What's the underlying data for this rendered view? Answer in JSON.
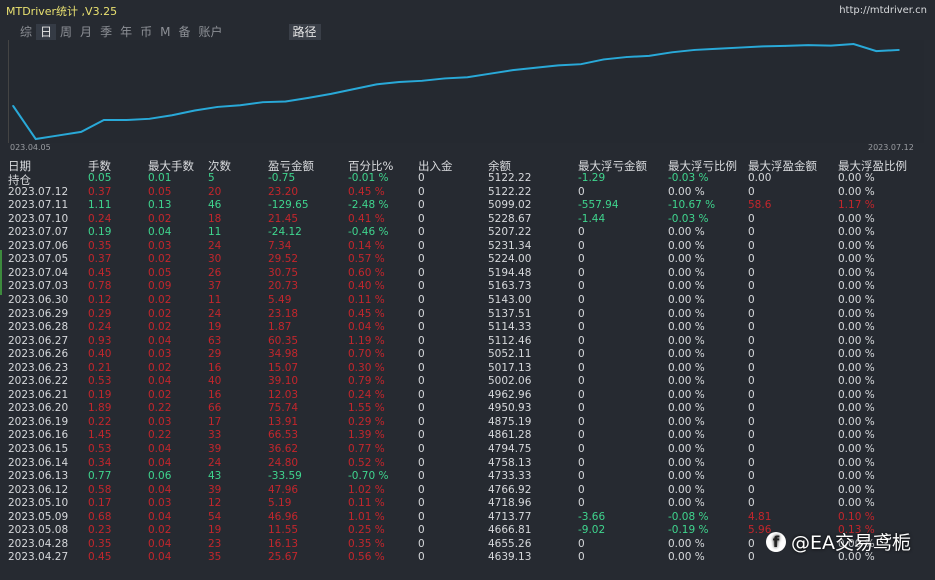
{
  "window": {
    "title": "MTDriver统计 ,V3.25",
    "url": "http://mtdriver.cn"
  },
  "tabs": [
    {
      "label": "综"
    },
    {
      "label": "日",
      "active": true
    },
    {
      "label": "周"
    },
    {
      "label": "月"
    },
    {
      "label": "季"
    },
    {
      "label": "年"
    },
    {
      "label": "币"
    },
    {
      "label": "M"
    },
    {
      "label": "备"
    },
    {
      "label": "账户"
    }
  ],
  "path_tab": "路径",
  "chart_data": {
    "type": "line",
    "x_start_label": "023.04.05",
    "x_end_label": "2023.07.12",
    "series": [
      {
        "name": "balance",
        "values": [
          4700,
          4560,
          4575,
          4590,
          4640,
          4640,
          4645,
          4660,
          4680,
          4695,
          4702,
          4715,
          4718,
          4733,
          4750,
          4770,
          4790,
          4800,
          4805,
          4815,
          4820,
          4835,
          4850,
          4860,
          4870,
          4875,
          4895,
          4905,
          4910,
          4925,
          4935,
          4940,
          4945,
          4950,
          4952,
          4955,
          4953,
          4960,
          4930,
          4935
        ]
      }
    ]
  },
  "table": {
    "headers": [
      "日期",
      "手数",
      "最大手数",
      "次数",
      "盈亏金额",
      "百分比%",
      "出入金",
      "余额",
      "最大浮亏金额",
      "最大浮亏比例",
      "最大浮盈金额",
      "最大浮盈比例"
    ],
    "rows": [
      {
        "c": "green",
        "v": [
          "持仓",
          "0.05",
          "0.01",
          "5",
          "-0.75",
          "-0.01 %",
          "0",
          "5122.22",
          "-1.29",
          "-0.03 %",
          "0.00",
          "0.00 %"
        ]
      },
      {
        "c": "red",
        "v": [
          "2023.07.12",
          "0.37",
          "0.05",
          "20",
          "23.20",
          "0.45 %",
          "0",
          "5122.22",
          "0",
          "0.00 %",
          "0",
          "0.00 %"
        ]
      },
      {
        "c": "green",
        "v": [
          "2023.07.11",
          "1.11",
          "0.13",
          "46",
          "-129.65",
          "-2.48 %",
          "0",
          "5099.02",
          "-557.94",
          "-10.67 %",
          "58.6",
          "1.17 %"
        ]
      },
      {
        "c": "red",
        "v": [
          "2023.07.10",
          "0.24",
          "0.02",
          "18",
          "21.45",
          "0.41 %",
          "0",
          "5228.67",
          "-1.44",
          "-0.03 %",
          "0",
          "0.00 %"
        ]
      },
      {
        "c": "green",
        "v": [
          "2023.07.07",
          "0.19",
          "0.04",
          "11",
          "-24.12",
          "-0.46 %",
          "0",
          "5207.22",
          "0",
          "0.00 %",
          "0",
          "0.00 %"
        ]
      },
      {
        "c": "red",
        "v": [
          "2023.07.06",
          "0.35",
          "0.03",
          "24",
          "7.34",
          "0.14 %",
          "0",
          "5231.34",
          "0",
          "0.00 %",
          "0",
          "0.00 %"
        ]
      },
      {
        "c": "red",
        "v": [
          "2023.07.05",
          "0.37",
          "0.02",
          "30",
          "29.52",
          "0.57 %",
          "0",
          "5224.00",
          "0",
          "0.00 %",
          "0",
          "0.00 %"
        ]
      },
      {
        "c": "red",
        "v": [
          "2023.07.04",
          "0.45",
          "0.05",
          "26",
          "30.75",
          "0.60 %",
          "0",
          "5194.48",
          "0",
          "0.00 %",
          "0",
          "0.00 %"
        ]
      },
      {
        "c": "red",
        "v": [
          "2023.07.03",
          "0.78",
          "0.09",
          "37",
          "20.73",
          "0.40 %",
          "0",
          "5163.73",
          "0",
          "0.00 %",
          "0",
          "0.00 %"
        ]
      },
      {
        "c": "red",
        "v": [
          "2023.06.30",
          "0.12",
          "0.02",
          "11",
          "5.49",
          "0.11 %",
          "0",
          "5143.00",
          "0",
          "0.00 %",
          "0",
          "0.00 %"
        ]
      },
      {
        "c": "red",
        "v": [
          "2023.06.29",
          "0.29",
          "0.02",
          "24",
          "23.18",
          "0.45 %",
          "0",
          "5137.51",
          "0",
          "0.00 %",
          "0",
          "0.00 %"
        ]
      },
      {
        "c": "red",
        "v": [
          "2023.06.28",
          "0.24",
          "0.02",
          "19",
          "1.87",
          "0.04 %",
          "0",
          "5114.33",
          "0",
          "0.00 %",
          "0",
          "0.00 %"
        ]
      },
      {
        "c": "red",
        "v": [
          "2023.06.27",
          "0.93",
          "0.04",
          "63",
          "60.35",
          "1.19 %",
          "0",
          "5112.46",
          "0",
          "0.00 %",
          "0",
          "0.00 %"
        ]
      },
      {
        "c": "red",
        "v": [
          "2023.06.26",
          "0.40",
          "0.03",
          "29",
          "34.98",
          "0.70 %",
          "0",
          "5052.11",
          "0",
          "0.00 %",
          "0",
          "0.00 %"
        ]
      },
      {
        "c": "red",
        "v": [
          "2023.06.23",
          "0.21",
          "0.02",
          "16",
          "15.07",
          "0.30 %",
          "0",
          "5017.13",
          "0",
          "0.00 %",
          "0",
          "0.00 %"
        ]
      },
      {
        "c": "red",
        "v": [
          "2023.06.22",
          "0.53",
          "0.04",
          "40",
          "39.10",
          "0.79 %",
          "0",
          "5002.06",
          "0",
          "0.00 %",
          "0",
          "0.00 %"
        ]
      },
      {
        "c": "red",
        "v": [
          "2023.06.21",
          "0.19",
          "0.02",
          "16",
          "12.03",
          "0.24 %",
          "0",
          "4962.96",
          "0",
          "0.00 %",
          "0",
          "0.00 %"
        ]
      },
      {
        "c": "red",
        "v": [
          "2023.06.20",
          "1.89",
          "0.22",
          "66",
          "75.74",
          "1.55 %",
          "0",
          "4950.93",
          "0",
          "0.00 %",
          "0",
          "0.00 %"
        ]
      },
      {
        "c": "red",
        "v": [
          "2023.06.19",
          "0.22",
          "0.03",
          "17",
          "13.91",
          "0.29 %",
          "0",
          "4875.19",
          "0",
          "0.00 %",
          "0",
          "0.00 %"
        ]
      },
      {
        "c": "red",
        "v": [
          "2023.06.16",
          "1.45",
          "0.22",
          "33",
          "66.53",
          "1.39 %",
          "0",
          "4861.28",
          "0",
          "0.00 %",
          "0",
          "0.00 %"
        ]
      },
      {
        "c": "red",
        "v": [
          "2023.06.15",
          "0.53",
          "0.04",
          "39",
          "36.62",
          "0.77 %",
          "0",
          "4794.75",
          "0",
          "0.00 %",
          "0",
          "0.00 %"
        ]
      },
      {
        "c": "red",
        "v": [
          "2023.06.14",
          "0.34",
          "0.04",
          "24",
          "24.80",
          "0.52 %",
          "0",
          "4758.13",
          "0",
          "0.00 %",
          "0",
          "0.00 %"
        ]
      },
      {
        "c": "green",
        "v": [
          "2023.06.13",
          "0.77",
          "0.06",
          "43",
          "-33.59",
          "-0.70 %",
          "0",
          "4733.33",
          "0",
          "0.00 %",
          "0",
          "0.00 %"
        ]
      },
      {
        "c": "red",
        "v": [
          "2023.06.12",
          "0.58",
          "0.04",
          "39",
          "47.96",
          "1.02 %",
          "0",
          "4766.92",
          "0",
          "0.00 %",
          "0",
          "0.00 %"
        ]
      },
      {
        "c": "red",
        "v": [
          "2023.05.10",
          "0.17",
          "0.03",
          "12",
          "5.19",
          "0.11 %",
          "0",
          "4718.96",
          "0",
          "0.00 %",
          "0",
          "0.00 %"
        ]
      },
      {
        "c": "red",
        "v": [
          "2023.05.09",
          "0.68",
          "0.04",
          "54",
          "46.96",
          "1.01 %",
          "0",
          "4713.77",
          "-3.66",
          "-0.08 %",
          "4.81",
          "0.10 %"
        ]
      },
      {
        "c": "red",
        "v": [
          "2023.05.08",
          "0.23",
          "0.02",
          "19",
          "11.55",
          "0.25 %",
          "0",
          "4666.81",
          "-9.02",
          "-0.19 %",
          "5.96",
          "0.13 %"
        ]
      },
      {
        "c": "red",
        "v": [
          "2023.04.28",
          "0.35",
          "0.04",
          "23",
          "16.13",
          "0.35 %",
          "0",
          "4655.26",
          "0",
          "0.00 %",
          "0",
          "0.00 %"
        ]
      },
      {
        "c": "red",
        "v": [
          "2023.04.27",
          "0.45",
          "0.04",
          "35",
          "25.67",
          "0.56 %",
          "0",
          "4639.13",
          "0",
          "0.00 %",
          "0",
          "0.00 %"
        ]
      }
    ]
  },
  "watermark": "@EA交易鸢栀",
  "colors": {
    "profit": "#c3262c",
    "loss": "#3fd58e",
    "line": "#29a9d8"
  }
}
